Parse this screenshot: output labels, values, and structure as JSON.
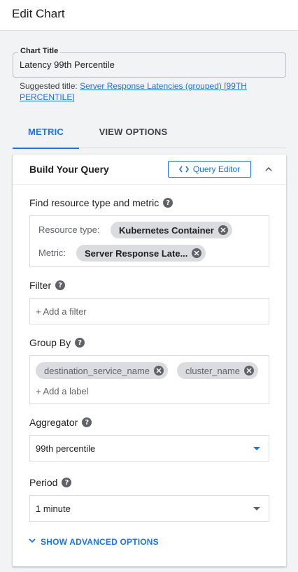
{
  "header": {
    "title": "Edit Chart"
  },
  "chart_title": {
    "label": "Chart Title",
    "value": "Latency 99th Percentile"
  },
  "suggested": {
    "prefix": "Suggested title:",
    "link": "Server Response Latencies (grouped) [99TH PERCENTILE]"
  },
  "tabs": [
    {
      "label": "METRIC",
      "active": true
    },
    {
      "label": "VIEW OPTIONS",
      "active": false
    }
  ],
  "query": {
    "title": "Build Your Query",
    "editor_label": "Query Editor",
    "find_label": "Find resource type and metric",
    "resource_label": "Resource type:",
    "resource_value": "Kubernetes Container",
    "metric_label": "Metric:",
    "metric_value": "Server Response Late...",
    "filter_label": "Filter",
    "filter_placeholder": "+ Add a filter",
    "groupby_label": "Group By",
    "groupby_chips": [
      "destination_service_name",
      "cluster_name"
    ],
    "groupby_placeholder": "+ Add a label",
    "aggregator_label": "Aggregator",
    "aggregator_value": "99th percentile",
    "period_label": "Period",
    "period_value": "1 minute",
    "advanced_label": "SHOW ADVANCED OPTIONS"
  },
  "colors": {
    "accent": "#1a73e8",
    "chip": "#dadce0",
    "icon": "#5f6368"
  }
}
